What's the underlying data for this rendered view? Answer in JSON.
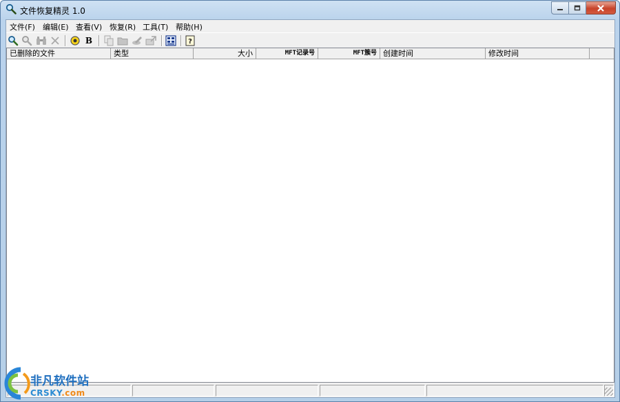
{
  "window": {
    "title": "文件恢复精灵 1.0",
    "icon": "magnifier-icon",
    "controls": [
      "minimize-icon",
      "maximize-icon",
      "close-icon"
    ]
  },
  "menu": [
    {
      "label": "文件(F)"
    },
    {
      "label": "编辑(E)"
    },
    {
      "label": "查看(V)"
    },
    {
      "label": "恢复(R)"
    },
    {
      "label": "工具(T)"
    },
    {
      "label": "帮助(H)"
    }
  ],
  "toolbar": [
    {
      "icon": "search-icon",
      "enabled": true
    },
    {
      "icon": "search-stop-icon",
      "enabled": false
    },
    {
      "icon": "binoculars-icon",
      "enabled": false
    },
    {
      "icon": "delete-icon",
      "enabled": false
    },
    {
      "icon": "target-icon",
      "enabled": true
    },
    {
      "icon": "bold-b-icon",
      "enabled": true,
      "glyph": "B"
    },
    {
      "icon": "copy-icon",
      "enabled": false
    },
    {
      "icon": "folder-icon",
      "enabled": false
    },
    {
      "icon": "recover-icon",
      "enabled": false
    },
    {
      "icon": "export-icon",
      "enabled": false
    },
    {
      "icon": "hex-view-icon",
      "enabled": true
    },
    {
      "icon": "help-icon",
      "enabled": true,
      "glyph": "?"
    }
  ],
  "list": {
    "columns": [
      {
        "label": "已删除的文件",
        "align": "left"
      },
      {
        "label": "类型",
        "align": "left"
      },
      {
        "label": "大小",
        "align": "right"
      },
      {
        "label": "MFT记录号",
        "align": "right"
      },
      {
        "label": "MFT簇号",
        "align": "right"
      },
      {
        "label": "创建时间",
        "align": "left"
      },
      {
        "label": "修改时间",
        "align": "left"
      }
    ],
    "rows": []
  },
  "statusbar": {
    "panes": [
      "",
      "",
      "",
      "",
      "",
      ""
    ]
  },
  "watermark": {
    "title": "非凡软件站",
    "sub_main": "CRSKY",
    "sub_tld": ".com"
  }
}
